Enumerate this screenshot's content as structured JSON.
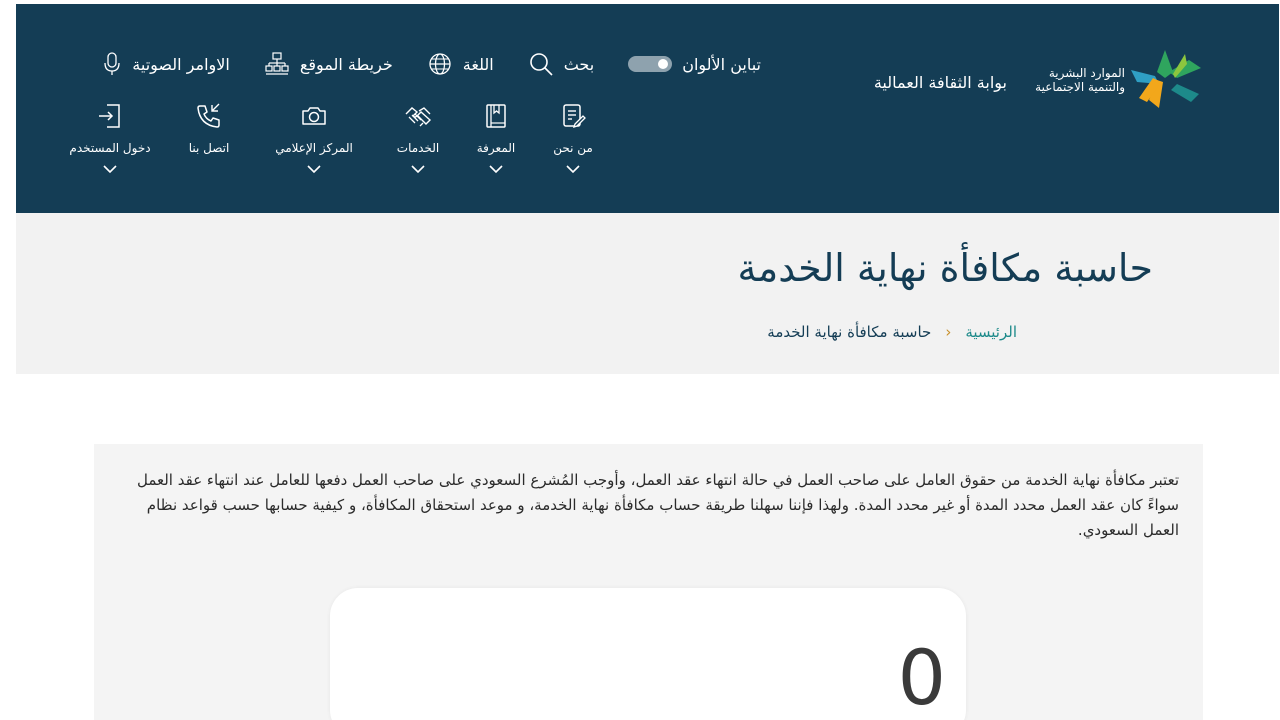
{
  "header": {
    "org_name_line1": "الموارد البشرية",
    "org_name_line2": "والتنمية الاجتماعية",
    "portal_title": "بوابة الثقافة العمالية",
    "utilities": {
      "contrast": "تباين الألوان",
      "search": "بحث",
      "language": "اللغة",
      "sitemap": "خريطة الموقع",
      "voice": "الاوامر الصوتية"
    },
    "nav": {
      "about": "من نحن",
      "knowledge": "المعرفة",
      "services": "الخدمات",
      "media": "المركز الإعلامي",
      "contact": "اتصل بنا",
      "login": "دخول المستخدم"
    },
    "colors": {
      "header_bg": "#143d55",
      "accent_teal": "#1d8a8a",
      "accent_gold": "#c8902b"
    }
  },
  "banner": {
    "title": "حاسبة مكافأة نهاية الخدمة",
    "breadcrumb": {
      "home": "الرئيسية",
      "separator": "‹",
      "current": "حاسبة مكافأة نهاية الخدمة"
    }
  },
  "intro": {
    "text": "تعتبر مكافأة نهاية الخدمة من حقوق العامل على صاحب العمل في حالة انتهاء عقد العمل، وأوجب المُشرع السعودي على صاحب العمل دفعها للعامل عند انتهاء عقد العمل سواءً كان عقد العمل محدد المدة أو غير محدد المدة. ولهذا فإننا سهلنا طريقة حساب مكافأة نهاية الخدمة، و موعد استحقاق المكافأة، و كيفية حسابها حسب قواعد نظام العمل السعودي."
  },
  "calculator": {
    "value": "0"
  }
}
